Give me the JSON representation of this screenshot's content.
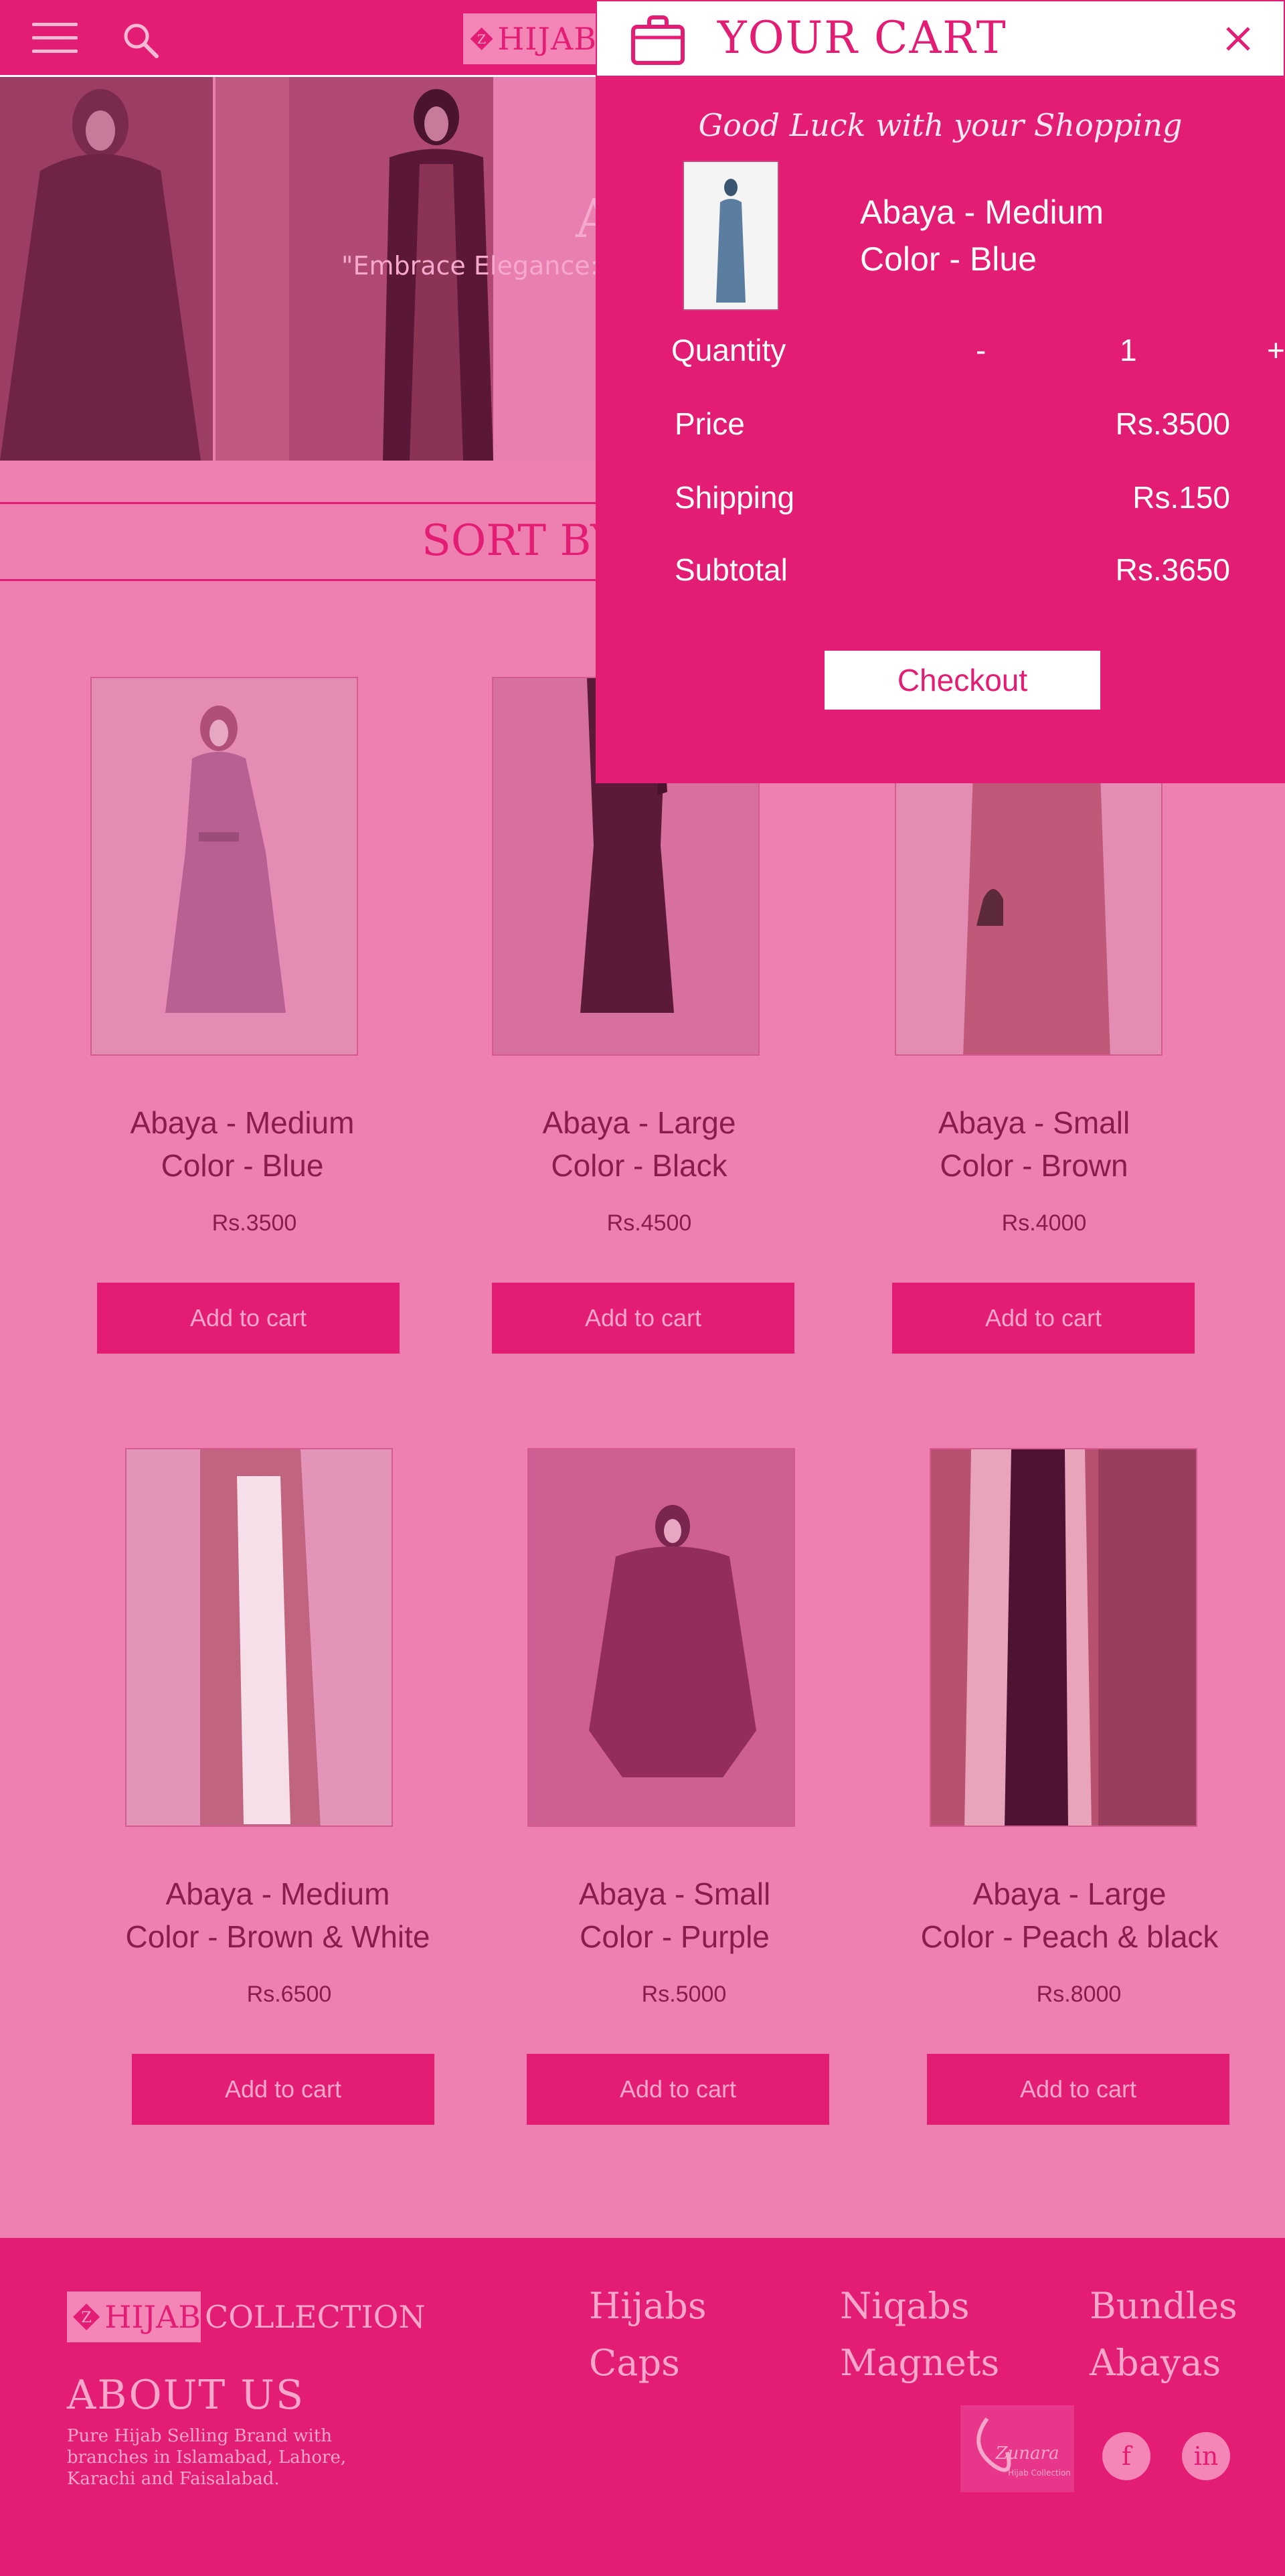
{
  "header": {
    "logo_text": "HIJAB",
    "icons": [
      "hamburger-menu-icon",
      "search-icon"
    ]
  },
  "hero": {
    "title": "A",
    "quote": "\"Embrace Elegance: D"
  },
  "sort": {
    "label": "SORT BY"
  },
  "products": [
    {
      "name_line1": "Abaya - Medium",
      "name_line2": "Color - Blue",
      "price": "Rs.3500",
      "button": "Add to cart"
    },
    {
      "name_line1": "Abaya - Large",
      "name_line2": "Color - Black",
      "price": "Rs.4500",
      "button": "Add to cart"
    },
    {
      "name_line1": "Abaya - Small",
      "name_line2": "Color - Brown",
      "price": "Rs.4000",
      "button": "Add to cart"
    },
    {
      "name_line1": "Abaya - Medium",
      "name_line2": "Color - Brown & White",
      "price": "Rs.6500",
      "button": "Add to cart"
    },
    {
      "name_line1": "Abaya - Small",
      "name_line2": "Color - Purple",
      "price": "Rs.5000",
      "button": "Add to cart"
    },
    {
      "name_line1": "Abaya - Large",
      "name_line2": "Color - Peach & black",
      "price": "Rs.8000",
      "button": "Add to cart"
    }
  ],
  "cart": {
    "title": "YOUR CART",
    "greeting": "Good Luck with your Shopping",
    "item_line1": "Abaya - Medium",
    "item_line2": "Color - Blue",
    "quantity_label": "Quantity",
    "qty_minus": "-",
    "qty_value": "1",
    "qty_plus": "+",
    "price_label": "Price",
    "price_value": "Rs.3500",
    "shipping_label": "Shipping",
    "shipping_value": "Rs.150",
    "subtotal_label": "Subtotal",
    "subtotal_value": "Rs.3650",
    "checkout": "Checkout"
  },
  "footer": {
    "logo_text": "HIJAB",
    "logo_suffix": "COLLECTION",
    "about_title": "ABOUT US",
    "about_text": "Pure Hijab Selling Brand with branches in Islamabad, Lahore, Karachi and Faisalabad.",
    "links": [
      "Hijabs",
      "Caps",
      "Niqabs",
      "Magnets",
      "Bundles",
      "Abayas"
    ],
    "brand_badge_text": "Zunara",
    "brand_badge_sub": "Hijab Collection",
    "social": [
      "f",
      "in"
    ]
  },
  "colors": {
    "brand": "#e41d74",
    "background": "#ee80b1",
    "light_text": "#f7a7c9",
    "product_text": "#8a1c4d"
  }
}
